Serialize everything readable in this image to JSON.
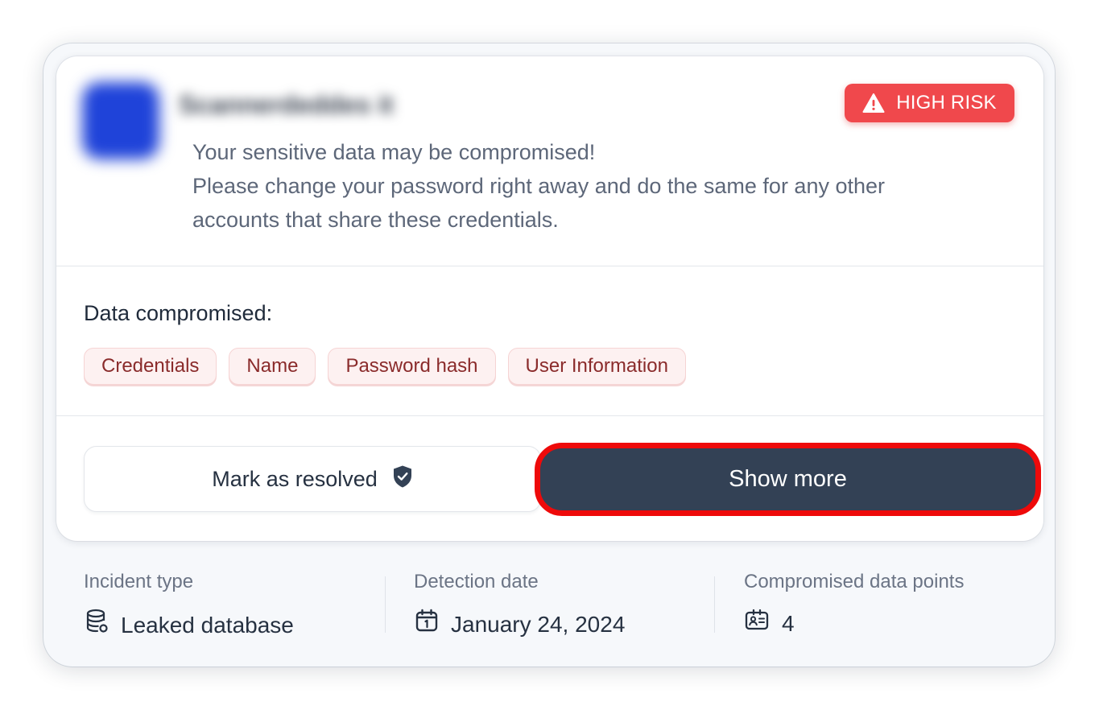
{
  "card": {
    "company_name": "Scannerdeddes it",
    "risk_badge": "HIGH RISK",
    "warning": {
      "line1": "Your sensitive data may be compromised!",
      "line2": "Please change your password right away and do the same for any other",
      "line3": "accounts that share these credentials."
    }
  },
  "data_compromised": {
    "title": "Data compromised:",
    "tags": [
      "Credentials",
      "Name",
      "Password hash",
      "User Information"
    ]
  },
  "actions": {
    "resolve_label": "Mark as resolved",
    "show_more_label": "Show more"
  },
  "meta": {
    "incident_type": {
      "label": "Incident type",
      "value": "Leaked database",
      "icon": "database-icon"
    },
    "detection_date": {
      "label": "Detection date",
      "value": "January 24, 2024",
      "icon": "calendar-icon"
    },
    "data_points": {
      "label": "Compromised data points",
      "value": "4",
      "icon": "id-card-icon"
    }
  },
  "colors": {
    "badge": "#f0484c",
    "show_more_bg": "#334155",
    "highlight_outline": "#ee0a0a",
    "tag_bg": "#fdf1f1",
    "tag_text": "#8a2b2b"
  }
}
